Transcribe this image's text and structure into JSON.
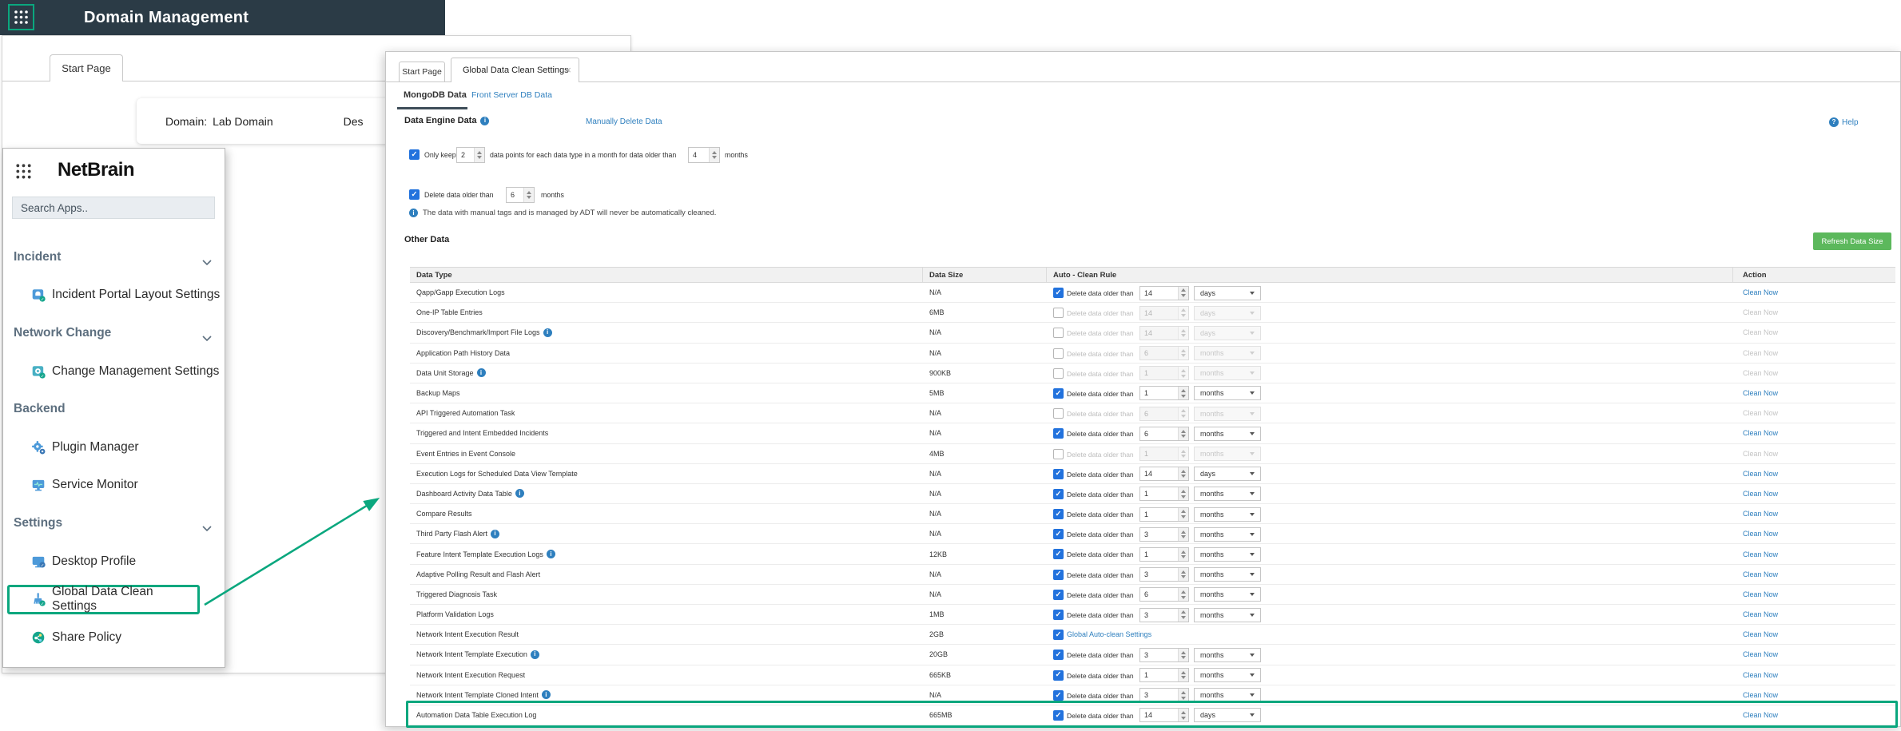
{
  "colors": {
    "accent_teal": "#0aa77e",
    "link_blue": "#2e7fbe",
    "checkbox_blue": "#2272dd",
    "button_green": "#5cb85c",
    "header_bg": "#2b3b46"
  },
  "header": {
    "title": "Domain Management"
  },
  "back_window": {
    "tab_label": "Start Page",
    "domain_label": "Domain:",
    "domain_value": "Lab Domain",
    "description_partial": "Des"
  },
  "app_menu": {
    "logo_text": "NetBrain",
    "search_placeholder": "Search Apps..",
    "sections": [
      {
        "label": "Incident",
        "chevron": true,
        "items": [
          {
            "label": "Incident Portal Layout Settings",
            "icon": "incident-portal-layout-icon"
          }
        ]
      },
      {
        "label": "Network Change",
        "chevron": true,
        "items": [
          {
            "label": "Change Management Settings",
            "icon": "change-management-icon"
          }
        ]
      },
      {
        "label": "Backend",
        "chevron": false,
        "items": [
          {
            "label": "Plugin Manager",
            "icon": "plugin-manager-icon"
          },
          {
            "label": "Service Monitor",
            "icon": "service-monitor-icon"
          }
        ]
      },
      {
        "label": "Settings",
        "chevron": true,
        "items": [
          {
            "label": "Desktop Profile",
            "icon": "desktop-profile-icon"
          },
          {
            "label": "Global Data Clean Settings",
            "icon": "global-data-clean-icon",
            "highlighted": true
          },
          {
            "label": "Share Policy",
            "icon": "share-policy-icon"
          }
        ]
      }
    ]
  },
  "panel": {
    "tabs": [
      {
        "label": "Start Page",
        "active": false
      },
      {
        "label": "Global Data Clean Settings",
        "active": true,
        "closable": true
      }
    ],
    "subtabs": [
      {
        "label": "MongoDB Data",
        "active": true
      },
      {
        "label": "Front Server DB Data",
        "active": false
      }
    ],
    "help_label": "Help",
    "data_engine": {
      "title": "Data Engine Data",
      "manual_delete_link": "Manually Delete Data",
      "rule1": {
        "checked": true,
        "prefix": "Only keep",
        "value": "2",
        "middle": "data points for each data type in a month for data older than",
        "value2": "4",
        "suffix": "months"
      },
      "rule2": {
        "checked": true,
        "prefix": "Delete data older than",
        "value": "6",
        "suffix": "months"
      },
      "note": "The data with manual tags and is managed by ADT will never be automatically cleaned."
    },
    "other_data": {
      "title": "Other Data",
      "refresh_button": "Refresh Data Size",
      "columns": [
        "Data Type",
        "Data Size",
        "Auto - Clean Rule",
        "Action"
      ],
      "rule_label": "Delete data older than",
      "action_label": "Clean Now",
      "rows": [
        {
          "type": "Qapp/Gapp Execution Logs",
          "info": false,
          "size": "N/A",
          "checked": true,
          "value": "14",
          "unit": "days",
          "action_enabled": true
        },
        {
          "type": "One-IP Table Entries",
          "info": false,
          "size": "6MB",
          "checked": false,
          "value": "14",
          "unit": "days",
          "action_enabled": false
        },
        {
          "type": "Discovery/Benchmark/Import File Logs",
          "info": true,
          "size": "N/A",
          "checked": false,
          "value": "14",
          "unit": "days",
          "action_enabled": false
        },
        {
          "type": "Application Path History Data",
          "info": false,
          "size": "N/A",
          "checked": false,
          "value": "6",
          "unit": "months",
          "action_enabled": false
        },
        {
          "type": "Data Unit Storage",
          "info": true,
          "size": "900KB",
          "checked": false,
          "value": "1",
          "unit": "months",
          "action_enabled": false
        },
        {
          "type": "Backup Maps",
          "info": false,
          "size": "5MB",
          "checked": true,
          "value": "1",
          "unit": "months",
          "action_enabled": true
        },
        {
          "type": "API Triggered Automation Task",
          "info": false,
          "size": "N/A",
          "checked": false,
          "value": "6",
          "unit": "months",
          "action_enabled": false
        },
        {
          "type": "Triggered and Intent Embedded Incidents",
          "info": false,
          "size": "N/A",
          "checked": true,
          "value": "6",
          "unit": "months",
          "action_enabled": true
        },
        {
          "type": "Event Entries in Event Console",
          "info": false,
          "size": "4MB",
          "checked": false,
          "value": "1",
          "unit": "months",
          "action_enabled": false
        },
        {
          "type": "Execution Logs for Scheduled Data View Template",
          "info": false,
          "size": "N/A",
          "checked": true,
          "value": "14",
          "unit": "days",
          "action_enabled": true
        },
        {
          "type": "Dashboard Activity Data Table",
          "info": true,
          "size": "N/A",
          "checked": true,
          "value": "1",
          "unit": "months",
          "action_enabled": true
        },
        {
          "type": "Compare Results",
          "info": false,
          "size": "N/A",
          "checked": true,
          "value": "1",
          "unit": "months",
          "action_enabled": true
        },
        {
          "type": "Third Party Flash Alert",
          "info": true,
          "size": "N/A",
          "checked": true,
          "value": "3",
          "unit": "months",
          "action_enabled": true
        },
        {
          "type": "Feature Intent Template Execution Logs",
          "info": true,
          "size": "12KB",
          "checked": true,
          "value": "1",
          "unit": "months",
          "action_enabled": true
        },
        {
          "type": "Adaptive Polling Result and Flash Alert",
          "info": false,
          "size": "N/A",
          "checked": true,
          "value": "3",
          "unit": "months",
          "action_enabled": true
        },
        {
          "type": "Triggered Diagnosis Task",
          "info": false,
          "size": "N/A",
          "checked": true,
          "value": "6",
          "unit": "months",
          "action_enabled": true
        },
        {
          "type": "Platform Validation Logs",
          "info": false,
          "size": "1MB",
          "checked": true,
          "value": "3",
          "unit": "months",
          "action_enabled": true
        },
        {
          "type": "Network Intent Execution Result",
          "info": false,
          "size": "2GB",
          "checked": true,
          "rule_link": "Global Auto-clean Settings",
          "action_enabled": true
        },
        {
          "type": "Network Intent Template Execution",
          "info": true,
          "size": "20GB",
          "checked": true,
          "value": "3",
          "unit": "months",
          "action_enabled": true
        },
        {
          "type": "Network Intent Execution Request",
          "info": false,
          "size": "665KB",
          "checked": true,
          "value": "1",
          "unit": "months",
          "action_enabled": true
        },
        {
          "type": "Network Intent Template Cloned Intent",
          "info": true,
          "size": "N/A",
          "checked": true,
          "value": "3",
          "unit": "months",
          "action_enabled": true
        },
        {
          "type": "Automation Data Table Execution Log",
          "info": false,
          "size": "665MB",
          "checked": true,
          "value": "14",
          "unit": "days",
          "action_enabled": true,
          "highlighted": true
        }
      ]
    }
  }
}
